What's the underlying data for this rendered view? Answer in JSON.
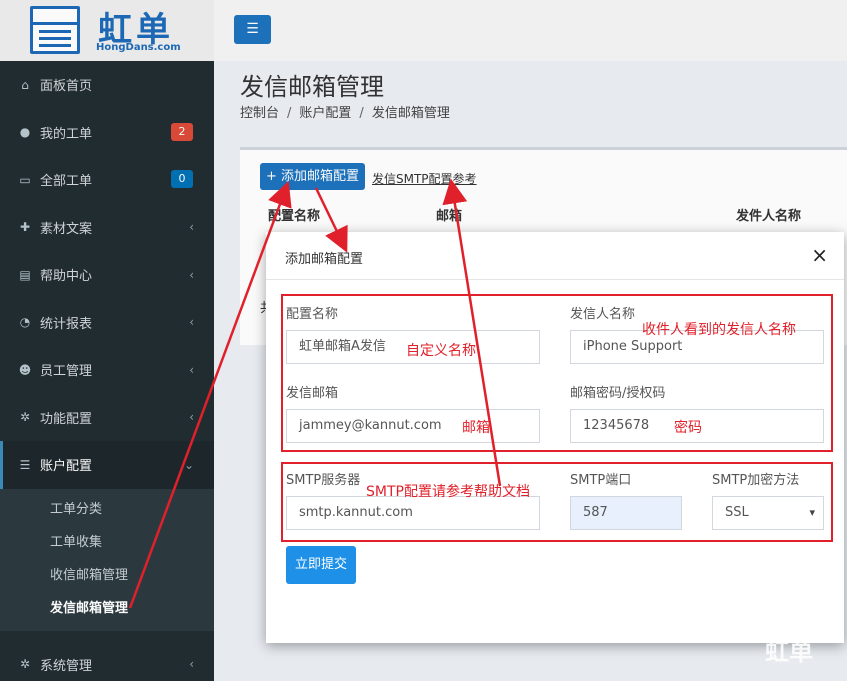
{
  "logo": {
    "text": "虹单",
    "sub": "HongDans.com"
  },
  "header": {
    "toggle_icon": "☰"
  },
  "sidebar": {
    "items": [
      {
        "label": "面板首页",
        "icon": "home-icon"
      },
      {
        "label": "我的工单",
        "icon": "user-circle-icon",
        "badge": "2"
      },
      {
        "label": "全部工单",
        "icon": "inbox-icon",
        "badge": "0"
      },
      {
        "label": "素材文案",
        "icon": "puzzle-icon"
      },
      {
        "label": "帮助中心",
        "icon": "file-icon"
      },
      {
        "label": "统计报表",
        "icon": "pie-chart-icon"
      },
      {
        "label": "员工管理",
        "icon": "users-icon"
      },
      {
        "label": "功能配置",
        "icon": "gear-icon"
      },
      {
        "label": "账户配置",
        "icon": "sliders-icon"
      },
      {
        "label": "系统管理",
        "icon": "gears-icon"
      }
    ],
    "submenu": [
      "工单分类",
      "工单收集",
      "收信邮箱管理",
      "发信邮箱管理"
    ]
  },
  "page": {
    "title": "发信邮箱管理",
    "breadcrumb": [
      "控制台",
      "账户配置",
      "发信邮箱管理"
    ],
    "add_button": "+ 添加邮箱配置",
    "ref_link": "发信SMTP配置参考",
    "columns": [
      "配置名称",
      "邮箱",
      "发件人名称"
    ],
    "stub": "共"
  },
  "modal": {
    "title": "添加邮箱配置",
    "close": "×",
    "fields": {
      "config_name_label": "配置名称",
      "config_name_value": "虹单邮箱A发信",
      "sender_name_label": "发信人名称",
      "sender_name_value": "iPhone Support",
      "email_label": "发信邮箱",
      "email_value": "jammey@kannut.com",
      "password_label": "邮箱密码/授权码",
      "password_value": "12345678",
      "smtp_server_label": "SMTP服务器",
      "smtp_server_value": "smtp.kannut.com",
      "smtp_port_label": "SMTP端口",
      "smtp_port_value": "587",
      "smtp_enc_label": "SMTP加密方法",
      "smtp_enc_value": "SSL"
    },
    "submit": "立即提交"
  },
  "annotations": {
    "custom_name": "自定义名称",
    "sender_seen": "收件人看到的发信人名称",
    "email": "邮箱",
    "password": "密码",
    "smtp_ref": "SMTP配置请参考帮助文档"
  },
  "watermark": "虹单",
  "colors": {
    "primary": "#1e73be",
    "sidebar": "#222d32",
    "annotation": "#e0202a"
  }
}
